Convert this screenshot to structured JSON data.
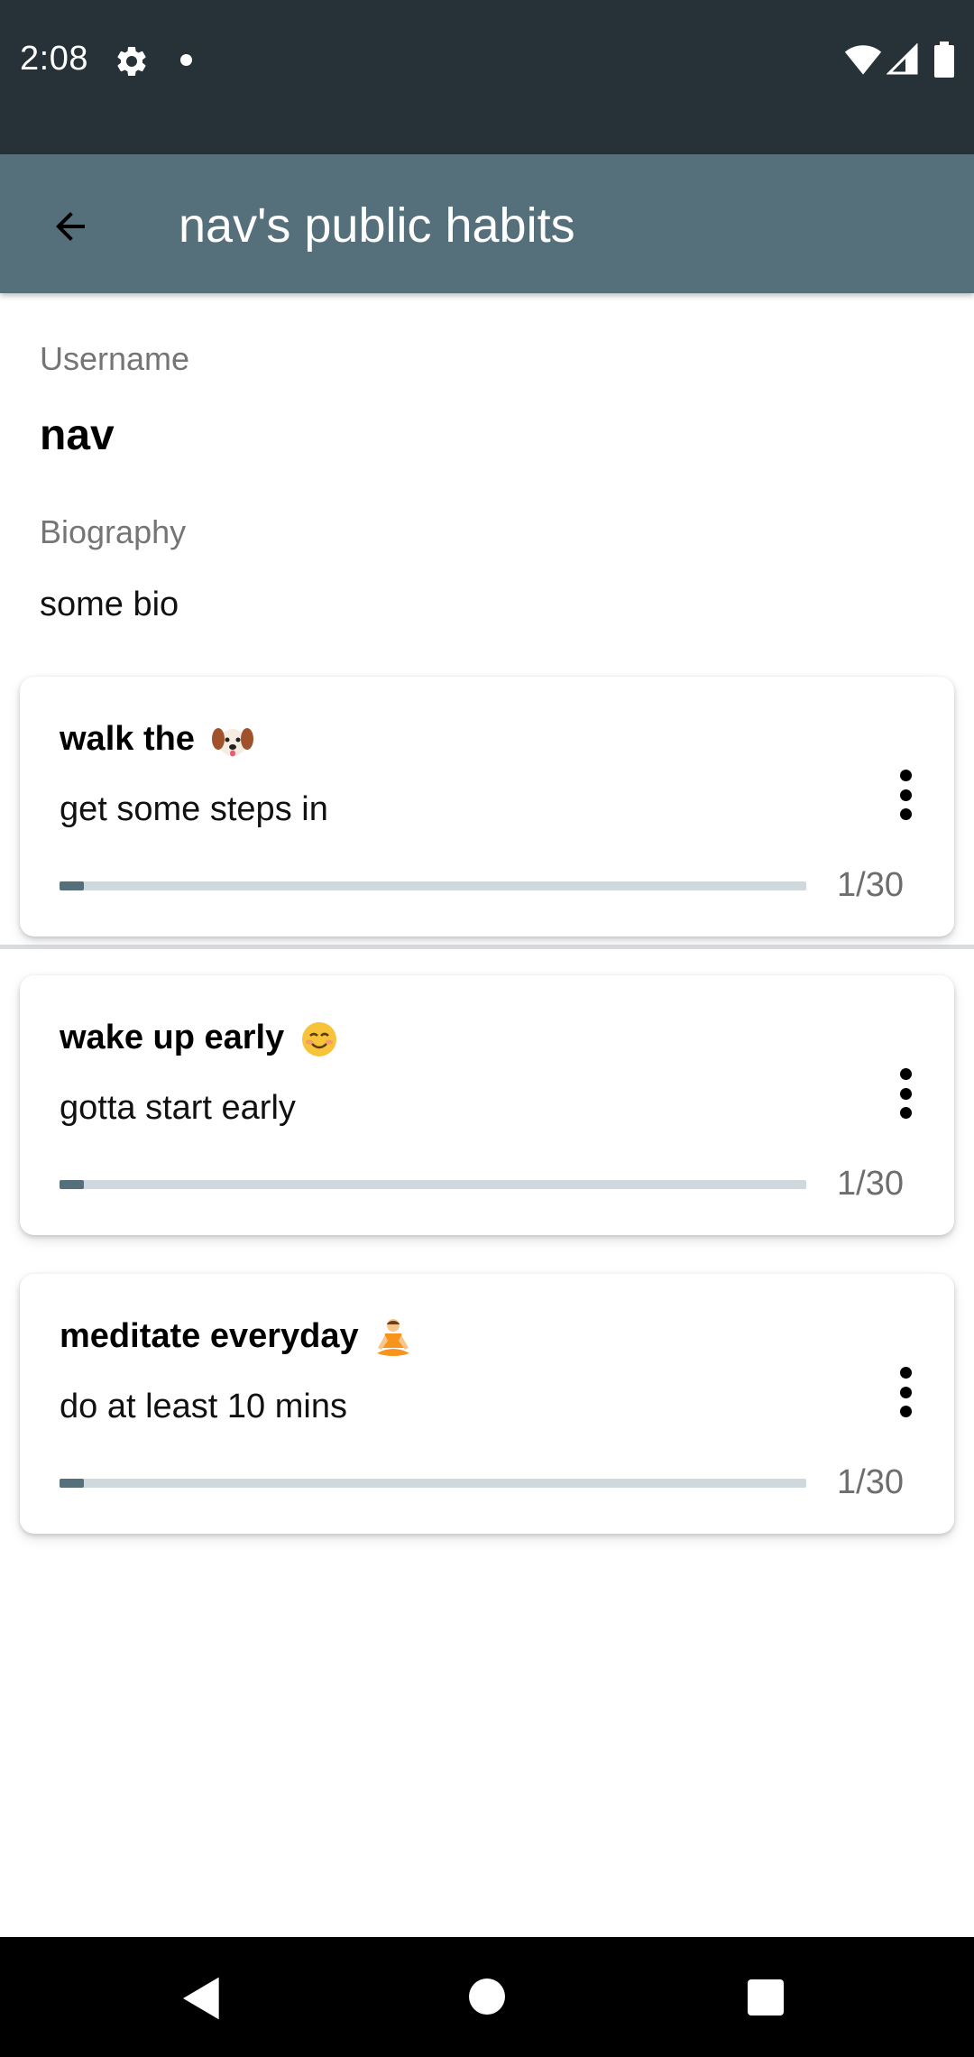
{
  "status_bar": {
    "time": "2:08",
    "icons": [
      "settings-icon",
      "notification-dot-icon",
      "wifi-icon",
      "cellular-signal-icon",
      "battery-icon"
    ]
  },
  "app_bar": {
    "title": "nav's public habits",
    "back_icon": "arrow-back-icon"
  },
  "profile": {
    "username_label": "Username",
    "username": "nav",
    "biography_label": "Biography",
    "biography": "some bio"
  },
  "habits": [
    {
      "title": "walk the",
      "emoji_icon": "dog-face-icon",
      "description": "get some steps in",
      "progress_text": "1/30",
      "progress": 0.033
    },
    {
      "title": "wake up early",
      "emoji_icon": "smiling-face-icon",
      "description": "gotta start early",
      "progress_text": "1/30",
      "progress": 0.033
    },
    {
      "title": "meditate everyday",
      "emoji_icon": "person-meditating-icon",
      "description": "do at least 10 mins",
      "progress_text": "1/30",
      "progress": 0.033
    }
  ],
  "colors": {
    "status_bar": "#263238",
    "app_bar": "#56707b",
    "progress_fill": "#56707b",
    "progress_track": "#cfd8dc"
  },
  "nav_bar": {
    "icons": [
      "nav-back-icon",
      "nav-home-icon",
      "nav-recents-icon"
    ]
  }
}
